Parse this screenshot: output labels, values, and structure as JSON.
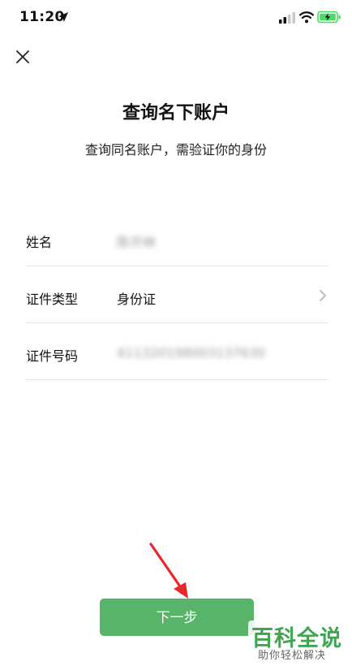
{
  "status_bar": {
    "time": "11:20"
  },
  "header": {
    "title": "查询名下账户",
    "subtitle": "查询同名账户，需验证你的身份"
  },
  "form": {
    "name": {
      "label": "姓名",
      "value": "陈开林"
    },
    "id_type": {
      "label": "证件类型",
      "value": "身份证"
    },
    "id_number": {
      "label": "证件号码",
      "value": "411320198003137630"
    }
  },
  "actions": {
    "next_label": "下一步"
  },
  "watermark": {
    "title": "百科全说",
    "subtitle": "助你轻松解决"
  },
  "colors": {
    "primary_button": "#58b46a",
    "watermark_green": "#3ea64f",
    "annotation_red": "#e8262b",
    "battery_green": "#4cd964"
  },
  "icons": {
    "close": "close-icon",
    "location": "location-arrow-icon",
    "signal": "cellular-signal-icon",
    "wifi": "wifi-icon",
    "battery": "battery-charging-icon",
    "chevron": "chevron-right-icon",
    "annotation": "red-arrow-annotation"
  }
}
